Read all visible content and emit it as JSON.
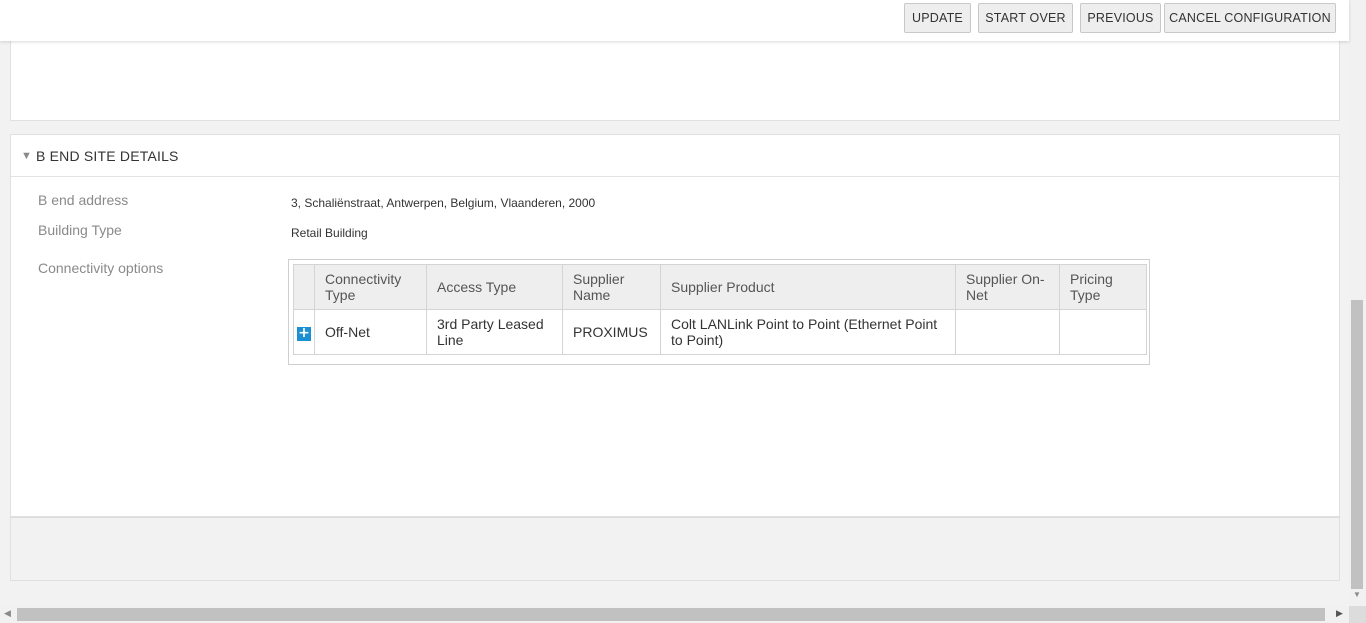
{
  "toolbar": {
    "update_label": "UPDATE",
    "start_over_label": "START OVER",
    "previous_label": "PREVIOUS",
    "cancel_label": "CANCEL CONFIGURATION"
  },
  "section": {
    "title": "B END SITE DETAILS",
    "caret": "▼"
  },
  "fields": {
    "address_label": "B end address",
    "address_value": "3, Schaliënstraat, Antwerpen, Belgium, Vlaanderen, 2000",
    "building_label": "Building Type",
    "building_value": "Retail Building",
    "connectivity_label": "Connectivity options"
  },
  "table": {
    "headers": [
      "Connectivity Type",
      "Access Type",
      "Supplier Name",
      "Supplier Product",
      "Supplier On-Net",
      "Pricing Type"
    ],
    "rows": [
      {
        "expand": "+",
        "connectivity_type": "Off-Net",
        "access_type": "3rd Party Leased Line",
        "supplier_name": "PROXIMUS",
        "supplier_product": "Colt LANLink Point to Point (Ethernet Point to Point)",
        "supplier_on_net": "",
        "pricing_type": ""
      }
    ]
  },
  "scrollbar": {
    "up": "▲",
    "down": "▼",
    "left": "◀",
    "right": "▶"
  },
  "colors": {
    "accent": "#1a8fd1",
    "button_bg": "#eeeeee",
    "header_bg": "#eeeeee"
  }
}
